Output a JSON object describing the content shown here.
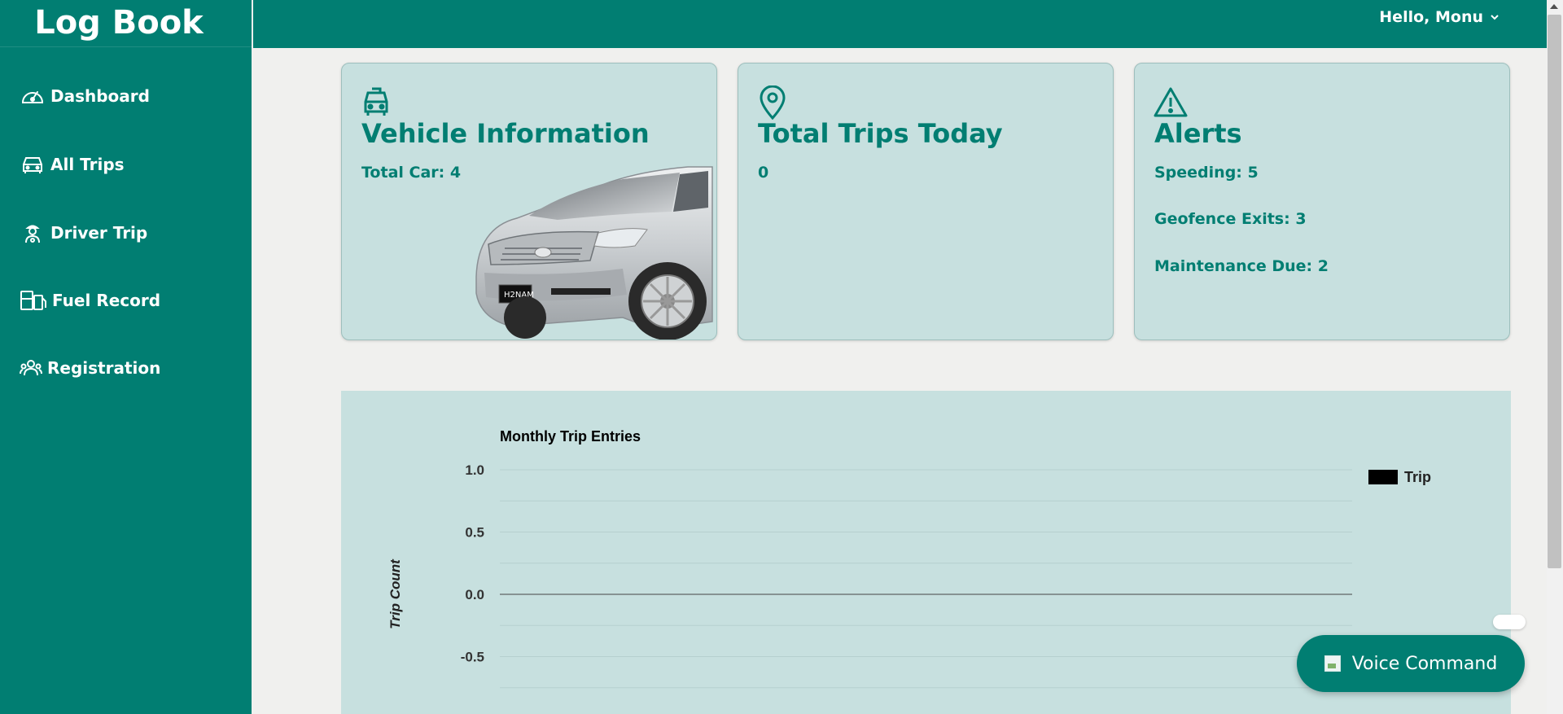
{
  "app": {
    "title": "Log Book"
  },
  "sidebar": {
    "items": [
      {
        "label": "Dashboard",
        "icon": "gauge-icon"
      },
      {
        "label": "All Trips",
        "icon": "car-icon"
      },
      {
        "label": "Driver Trip",
        "icon": "driver-icon"
      },
      {
        "label": "Fuel Record",
        "icon": "fuel-icon"
      },
      {
        "label": "Registration",
        "icon": "users-icon"
      }
    ]
  },
  "header": {
    "greeting": "Hello, Monu"
  },
  "cards": {
    "vehicle": {
      "title": "Vehicle Information",
      "total_car": "Total Car: 4"
    },
    "trips": {
      "title": "Total Trips Today",
      "count": "0"
    },
    "alerts": {
      "title": "Alerts",
      "speeding": "Speeding: 5",
      "geofence": "Geofence Exits: 3",
      "maintenance": "Maintenance Due: 2"
    }
  },
  "chart_data": {
    "type": "bar",
    "title": "Monthly Trip Entries",
    "ylabel": "Trip Count",
    "xlabel": "",
    "ylim": [
      -0.6,
      1.0
    ],
    "yticks": [
      "1.0",
      "0.5",
      "0.0",
      "-0.5"
    ],
    "ytick_values": [
      1.0,
      0.5,
      0.0,
      -0.5
    ],
    "series": [
      {
        "name": "Trip",
        "values": [],
        "color": "#000000"
      }
    ],
    "legend": "top-right",
    "grid": true
  },
  "voice": {
    "label": "Voice Command"
  },
  "colors": {
    "primary": "#017e72",
    "card_bg": "#c7e0df",
    "page_bg": "#f0f0ee"
  }
}
